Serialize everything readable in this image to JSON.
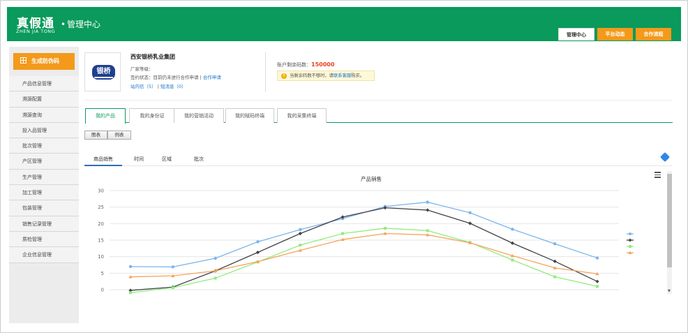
{
  "header": {
    "logo_cn": "真假通",
    "logo_en": "ZHEN JIA TONG",
    "logo_dot": "•",
    "subtitle": "管理中心",
    "tabs": [
      "管理中心",
      "平台动态",
      "合作流程"
    ]
  },
  "sidebar": {
    "generate_button": "生成防伪码",
    "items": [
      "产品信息管理",
      "溯源配置",
      "溯源查询",
      "投入品管理",
      "批次管理",
      "产区管理",
      "生产管理",
      "加工管理",
      "包装管理",
      "销售记录管理",
      "质检管理",
      "企业信息管理"
    ]
  },
  "company": {
    "logo_text": "银桥",
    "name": "西安银桥乳业集团",
    "level_label": "厂家等级：",
    "status_label": "签约状态：目前仍未进行合作申请",
    "separator": "|",
    "apply_link": "合作申请",
    "inbox_link": "站内信（5）",
    "sms_link": "短消息（0）"
  },
  "account": {
    "balance_label": "账户剩余码数：",
    "balance_value": "150000",
    "notice_icon": "!",
    "notice_text": "当剩余码数不够时，请",
    "notice_link": "联系客服",
    "notice_suffix": "购买。"
  },
  "subtabs": [
    "我的产品",
    "我的身份证",
    "我的营销活动",
    "我的赋码终端",
    "我的采集终端"
  ],
  "view_buttons": [
    "图表",
    "例表"
  ],
  "chart_tabs": [
    "商品销售",
    "时间",
    "区域",
    "批次"
  ],
  "chart_data": {
    "type": "line",
    "title": "产品销售",
    "ylim": [
      0,
      30
    ],
    "yticks": [
      0,
      5,
      10,
      15,
      20,
      25,
      30
    ],
    "x": [
      1,
      2,
      3,
      4,
      5,
      6,
      7,
      8,
      9,
      10,
      11,
      12
    ],
    "grid": true,
    "legend": "right",
    "series": [
      {
        "color": "#7cb5ec",
        "marker": "circle",
        "values": [
          7.0,
          6.9,
          9.5,
          14.5,
          18.2,
          21.5,
          25.2,
          26.5,
          23.3,
          18.3,
          13.9,
          9.6
        ]
      },
      {
        "color": "#434348",
        "marker": "diamond",
        "values": [
          -0.2,
          0.8,
          5.7,
          11.3,
          17.0,
          22.0,
          24.8,
          24.1,
          20.1,
          14.1,
          8.6,
          2.5
        ]
      },
      {
        "color": "#90ed7d",
        "marker": "square",
        "values": [
          -0.9,
          0.6,
          3.5,
          8.4,
          13.5,
          17.0,
          18.6,
          17.9,
          14.3,
          9.0,
          3.9,
          1.0
        ]
      },
      {
        "color": "#f7a35c",
        "marker": "triangle",
        "values": [
          3.9,
          4.2,
          5.7,
          8.5,
          11.9,
          15.2,
          17.0,
          16.6,
          14.2,
          10.3,
          6.6,
          4.8
        ]
      }
    ]
  }
}
